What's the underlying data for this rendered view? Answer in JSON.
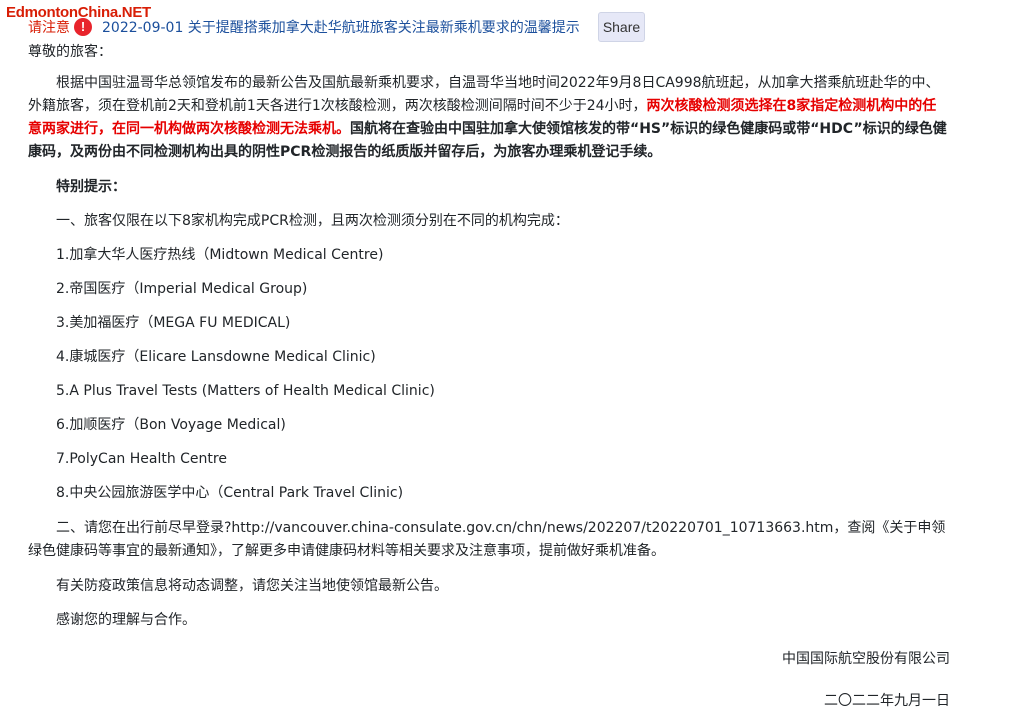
{
  "watermark": "EdmontonChina.NET",
  "header": {
    "notice_label": "请注意",
    "alert_icon": "!",
    "headline": "2022-09-01 关于提醒搭乘加拿大赴华航班旅客关注最新乘机要求的温馨提示",
    "share_label": "Share"
  },
  "article": {
    "greeting": "尊敬的旅客：",
    "para1_normal": "根据中国驻温哥华总领馆发布的最新公告及国航最新乘机要求，自温哥华当地时间2022年9月8日CA998航班起，从加拿大搭乘航班赴华的中、外籍旅客，须在登机前2天和登机前1天各进行1次核酸检测，两次核酸检测间隔时间不少于24小时，",
    "para1_red": "两次核酸检测须选择在8家指定检测机构中的任意两家进行，在同一机构做两次核酸检测无法乘机。",
    "para1_bold": "国航将在查验由中国驻加拿大使领馆核发的带“HS”标识的绿色健康码或带“HDC”标识的绿色健康码，及两份由不同检测机构出具的阴性PCR检测报告的纸质版并留存后，为旅客办理乘机登记手续。",
    "special_heading": "特别提示：",
    "section1_intro": "一、旅客仅限在以下8家机构完成PCR检测，且两次检测须分别在不同的机构完成：",
    "clinics": [
      "1.加拿大华人医疗热线（Midtown Medical Centre)",
      "2.帝国医疗（Imperial Medical Group)",
      "3.美加福医疗（MEGA FU MEDICAL)",
      "4.康城医疗（Elicare Lansdowne Medical Clinic)",
      "5.A Plus Travel Tests (Matters of Health Medical Clinic)",
      "6.加顺医疗（Bon Voyage Medical)",
      "7.PolyCan Health Centre",
      "8.中央公园旅游医学中心（Central Park Travel Clinic)"
    ],
    "section2": "二、请您在出行前尽早登录?http://vancouver.china-consulate.gov.cn/chn/news/202207/t20220701_10713663.htm，查阅《关于申领绿色健康码等事宜的最新通知》，了解更多申请健康码材料等相关要求及注意事项，提前做好乘机准备。",
    "policy_note": "有关防疫政策信息将动态调整，请您关注当地使领馆最新公告。",
    "thanks": "感谢您的理解与合作。",
    "signature_company": "中国国际航空股份有限公司",
    "signature_date": "二〇二二年九月一日"
  }
}
